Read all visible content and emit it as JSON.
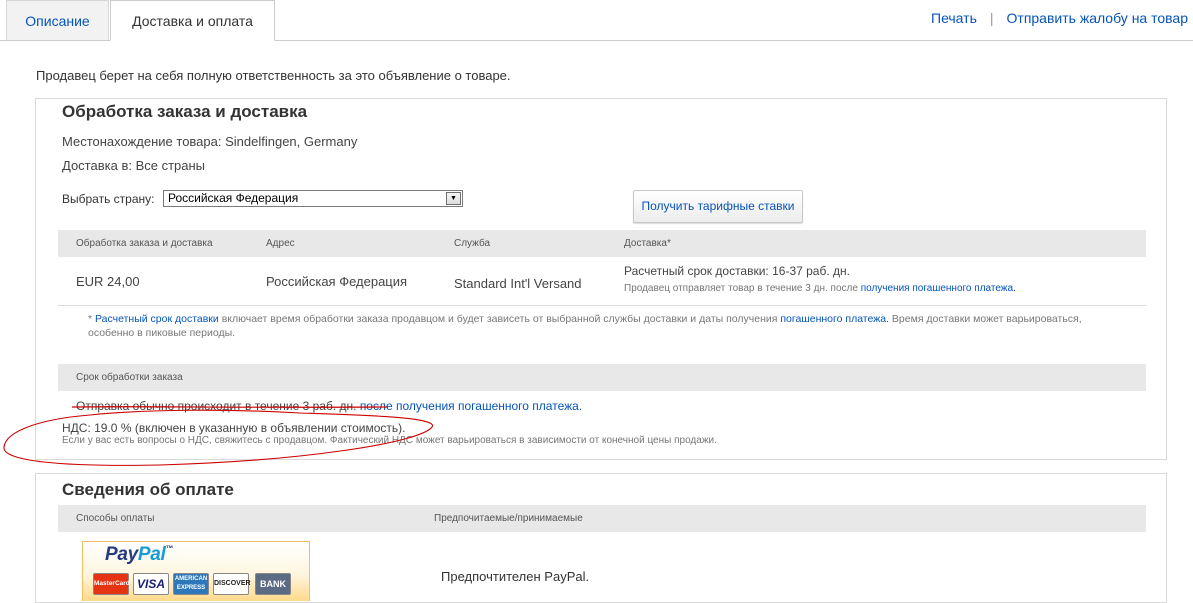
{
  "tabs": [
    {
      "label": "Описание",
      "active": false
    },
    {
      "label": "Доставка и оплата",
      "active": true
    }
  ],
  "top_links": {
    "print": "Печать",
    "separator": "|",
    "report": "Отправить жалобу на товар"
  },
  "seller_note": "Продавец берет на себя полную ответственность за это объявление о товаре.",
  "shipping": {
    "title": "Обработка заказа и доставка",
    "location": "Местонахождение товара: Sindelfingen, Germany",
    "ships_to": "Доставка в: Все страны",
    "country_label": "Выбрать страну:",
    "country_value": "Российская Федерация",
    "rates_button": "Получить тарифные ставки",
    "table_headers": [
      "Обработка заказа и доставка",
      "Адрес",
      "Служба",
      "Доставка*"
    ],
    "row": {
      "cost": "EUR 24,00",
      "address": "Российская Федерация",
      "service": "Standard Int'l Versand",
      "delivery_main": "Расчетный срок доставки: 16-37 раб. дн.",
      "delivery_sub_prefix": "Продавец отправляет товар в течение 3 дн. после",
      "delivery_sub_link": "получения погашенного платежа."
    },
    "footnote": {
      "star": "*",
      "link1": "Расчетный срок доставки",
      "text1": "включает время обработки заказа продавцом и будет зависеть от выбранной службы доставки и даты получения",
      "link2": "погашенного платежа.",
      "text2": "Время доставки может варьироваться, особенно в пиковые периоды."
    },
    "handling_header": "Срок обработки заказа",
    "handling_text": "Отправка обычно происходит в течение 3 раб. дн.",
    "handling_link": "после получения погашенного платежа.",
    "vat_line": "НДС: 19.0 % (включен в указанную в объявлении стоимость).",
    "vat_note": "Если у вас есть вопросы о НДС, свяжитесь с продавцом. Фактический НДС может варьироваться в зависимости от конечной цены продажи."
  },
  "payment": {
    "title": "Сведения об оплате",
    "headers": [
      "Способы оплаты",
      "Предпочитаемые/принимаемые"
    ],
    "paypal_logo": {
      "part1": "Pay",
      "part2": "Pal",
      "tm": "™"
    },
    "cards": [
      "MasterCard",
      "VISA",
      "AMERICAN EXPRESS",
      "DISCOVER",
      "BANK"
    ],
    "preferred_text": "Предпочтителен PayPal."
  },
  "colors": {
    "link": "#0654ba",
    "annotation": "#cc0000",
    "header_bg": "#e8e8e8"
  }
}
